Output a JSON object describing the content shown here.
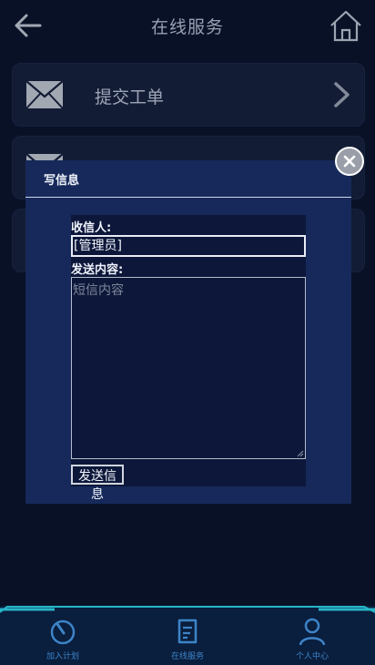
{
  "header": {
    "title": "在线服务"
  },
  "menu": [
    {
      "label": "提交工单"
    },
    {
      "label": ""
    },
    {
      "label": ""
    }
  ],
  "dialog": {
    "title": "写信息",
    "recipient_label": "收信人:",
    "recipient_value": "[管理员]",
    "content_label": "发送内容:",
    "content_placeholder": "短信内容",
    "send_label": "发送信息"
  },
  "tabbar": [
    {
      "label": "加入计划",
      "icon": "plan-icon"
    },
    {
      "label": "在线服务",
      "icon": "service-icon"
    },
    {
      "label": "个人中心",
      "icon": "user-icon"
    }
  ],
  "colors": {
    "background": "#0b132b",
    "card": "#18223f",
    "dialog": "#16295a",
    "tab_accent": "#3d84c8",
    "frame_accent": "#27b6c8"
  }
}
